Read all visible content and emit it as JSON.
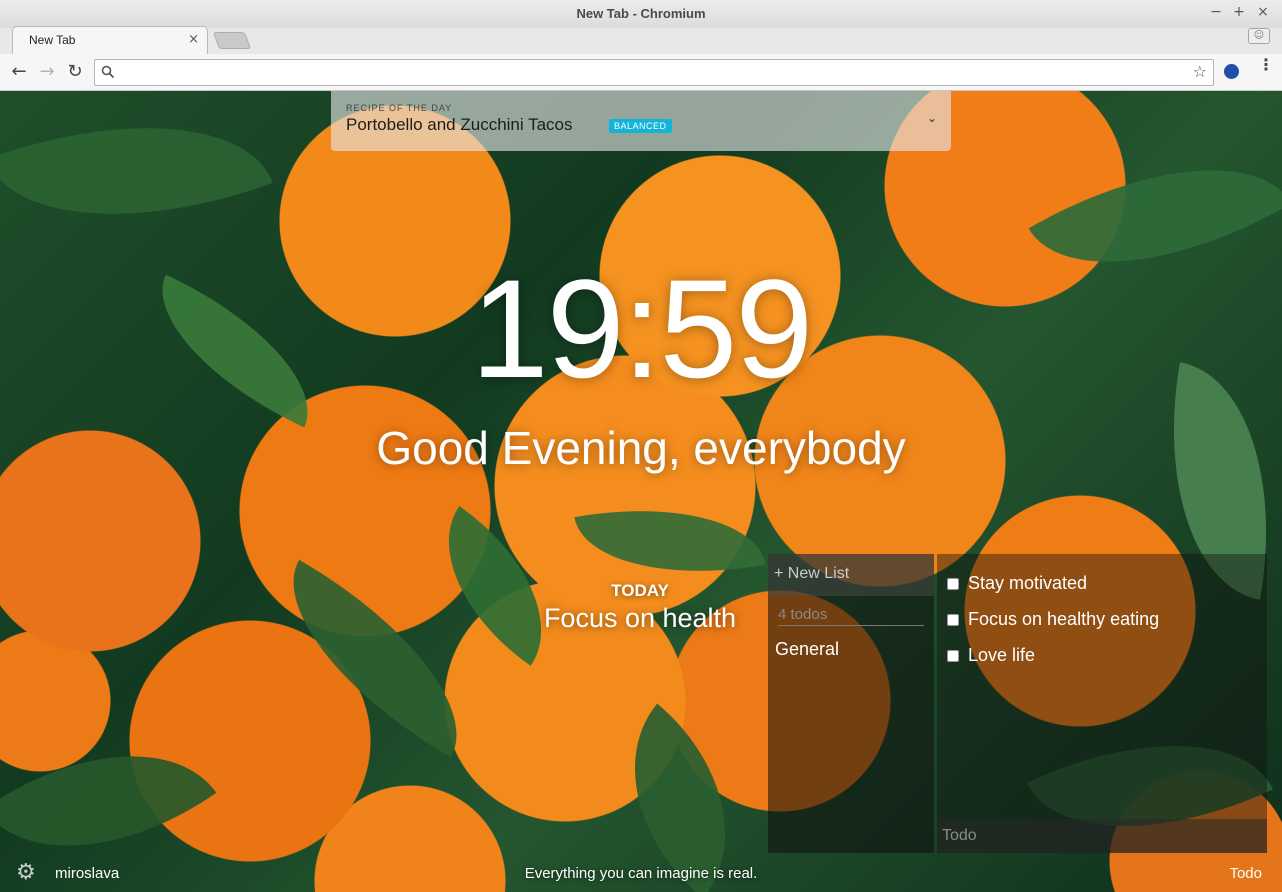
{
  "window": {
    "title": "New Tab - Chromium",
    "minimize": "−",
    "maximize": "+",
    "close": "×"
  },
  "tab": {
    "title": "New Tab",
    "close": "×"
  },
  "toolbar": {
    "back": "←",
    "forward": "→",
    "reload": "↻",
    "omnibox_value": "",
    "star": "☆",
    "menu": "⋮"
  },
  "recipe": {
    "kicker": "RECIPE OF THE DAY",
    "title": "Portobello and Zucchini Tacos",
    "badge": "BALANCED",
    "chevron": "⌄"
  },
  "clock": "19:59",
  "greeting": "Good Evening, everybody",
  "focus": {
    "label": "TODAY",
    "text": "Focus on health"
  },
  "todo": {
    "new_list": "+ New List",
    "count": "4 todos",
    "list_name": "General",
    "items": [
      {
        "text": "Stay motivated",
        "done": false
      },
      {
        "text": "Focus on healthy eating",
        "done": false
      },
      {
        "text": "Love life",
        "done": false
      }
    ],
    "input_placeholder": "Todo"
  },
  "footer": {
    "settings_icon": "⚙",
    "username": "miroslava",
    "quote": "Everything you can imagine is real.",
    "todo_link": "Todo"
  }
}
